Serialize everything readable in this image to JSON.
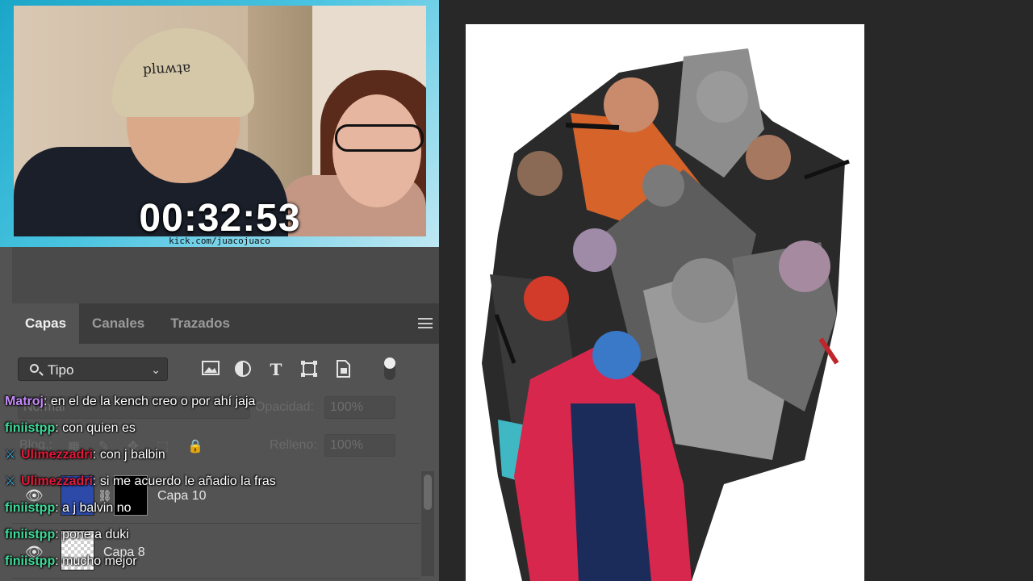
{
  "stream": {
    "timer": "00:32:53",
    "watermark": "kick.com/juacojuaco",
    "cap_text": "pluʍʇɐ"
  },
  "photoshop": {
    "tabs": [
      {
        "label": "Capas",
        "active": true
      },
      {
        "label": "Canales",
        "active": false
      },
      {
        "label": "Trazados",
        "active": false
      }
    ],
    "filter": {
      "label": "Tipo"
    },
    "filter_icons": [
      "image-icon",
      "adjustment-icon",
      "type-icon",
      "shape-icon",
      "smart-object-icon"
    ],
    "blend_mode": "Normal",
    "opacity_label": "Opacidad:",
    "opacity_value": "100%",
    "lock_label": "Bloq.:",
    "fill_label": "Relleno:",
    "fill_value": "100%",
    "layers": [
      {
        "name": "Capa 10"
      },
      {
        "name": "Capa 8"
      }
    ]
  },
  "chat": [
    {
      "user": "Matroj",
      "color": "#c58af9",
      "badge": false,
      "text": "en el de la kench creo o por ahí jaja"
    },
    {
      "user": "finiistpp",
      "color": "#3fdc9a",
      "badge": false,
      "text": "con quien es"
    },
    {
      "user": "Ulimezzadri",
      "color": "#e21a3a",
      "badge": true,
      "text": "con j balbin"
    },
    {
      "user": "Ulimezzadri",
      "color": "#e21a3a",
      "badge": true,
      "text": "si me acuerdo le añadio la fras"
    },
    {
      "user": "finiistpp",
      "color": "#3fdc9a",
      "badge": false,
      "text": "a j balvin no"
    },
    {
      "user": "finiistpp",
      "color": "#3fdc9a",
      "badge": false,
      "text": "pone a duki"
    },
    {
      "user": "finiistpp",
      "color": "#3fdc9a",
      "badge": false,
      "text": "mucho mejor"
    }
  ]
}
